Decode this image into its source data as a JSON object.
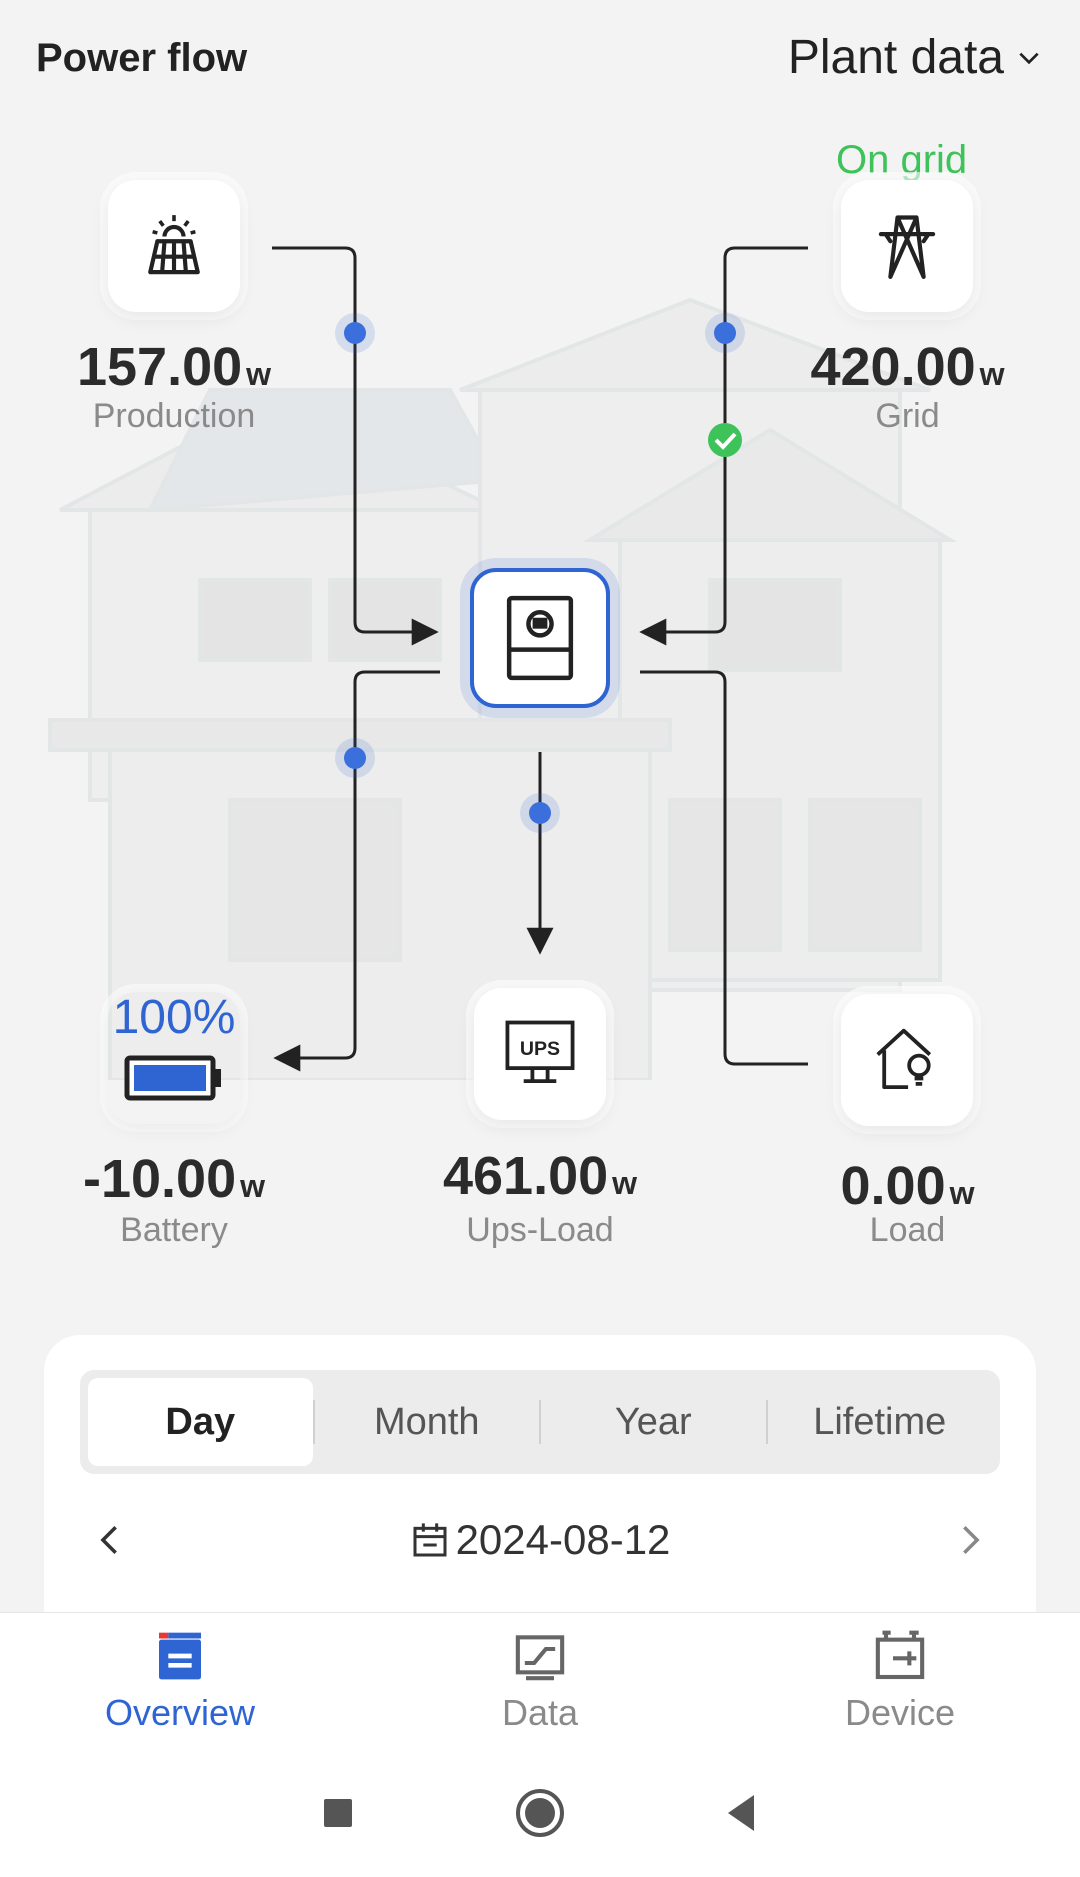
{
  "header": {
    "title": "Power flow",
    "plant_selector": "Plant data",
    "plant_selector_icon": "chevron-down-icon"
  },
  "flow": {
    "production": {
      "value": "157.00",
      "unit": "w",
      "label": "Production",
      "icon": "solar-panel-icon"
    },
    "grid": {
      "status": "On grid",
      "value": "420.00",
      "unit": "w",
      "label": "Grid",
      "icon": "power-tower-icon"
    },
    "inverter": {
      "icon": "inverter-icon"
    },
    "battery": {
      "percent": "100%",
      "value": "-10.00",
      "unit": "w",
      "label": "Battery",
      "icon": "battery-icon"
    },
    "ups_load": {
      "value": "461.00",
      "unit": "w",
      "label": "Ups-Load",
      "icon": "ups-icon"
    },
    "load": {
      "value": "0.00",
      "unit": "w",
      "label": "Load",
      "icon": "home-bulb-icon"
    },
    "colors": {
      "accent": "#2f64d3",
      "ok": "#3ec25a",
      "line": "#222222"
    }
  },
  "period": {
    "tabs": [
      "Day",
      "Month",
      "Year",
      "Lifetime"
    ],
    "selected": "Day",
    "date": "2024-08-12"
  },
  "bottom_nav": {
    "items": [
      {
        "label": "Overview",
        "icon": "overview-icon",
        "active": true
      },
      {
        "label": "Data",
        "icon": "data-chart-icon",
        "active": false
      },
      {
        "label": "Device",
        "icon": "device-icon",
        "active": false
      }
    ]
  },
  "system_nav": [
    "recents-square-icon",
    "home-circle-icon",
    "back-triangle-icon"
  ]
}
